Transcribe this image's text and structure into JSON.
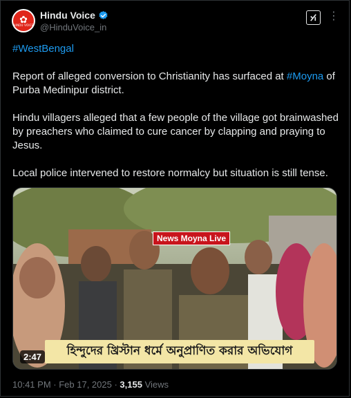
{
  "account": {
    "name": "Hindu Voice",
    "handle": "@HinduVoice_in",
    "avatar_text": "HINDU VOICE"
  },
  "post": {
    "hashtag_line": "#WestBengal",
    "para1_pre": "Report of alleged conversion to Christianity has surfaced at ",
    "para1_link": "#Moyna",
    "para1_post": " of Purba Medinipur district.",
    "para2": "Hindu villagers alleged that a few people of the village got brainwashed by preachers who claimed to cure cancer by clapping and praying to Jesus.",
    "para3": "Local police intervened to restore normalcy but situation is still tense."
  },
  "video": {
    "live_label": "News Moyna Live",
    "chyron": "হিন্দুদের খ্রিস্টান ধর্মে অনুপ্রাণিত করার অভিযোগ",
    "duration": "2:47"
  },
  "footer": {
    "time": "10:41 PM",
    "sep1": " · ",
    "date": "Feb 17, 2025",
    "sep2": " · ",
    "views_count": "3,155",
    "views_label": " Views"
  },
  "colors": {
    "link": "#1d9bf0",
    "verified": "#1d9bf0",
    "bg": "#000000",
    "muted": "#71767b"
  },
  "icons": {
    "verified": "verified-badge-icon",
    "grok": "grok-icon",
    "more": "more-options-icon"
  }
}
